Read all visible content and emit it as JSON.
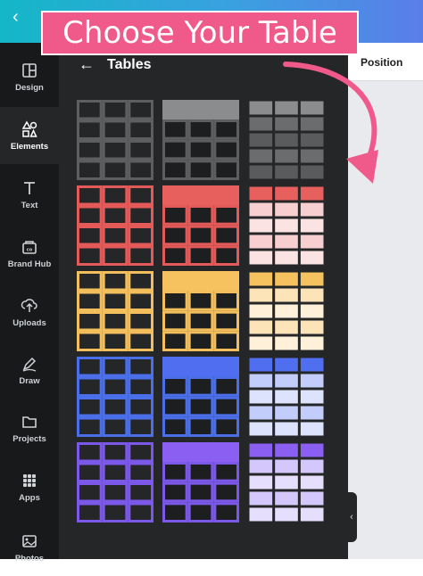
{
  "callout": {
    "text": "Choose Your Table"
  },
  "panel": {
    "title": "Tables"
  },
  "right": {
    "position_label": "Position"
  },
  "rail": {
    "items": [
      {
        "label": "Design",
        "icon": "layout-icon"
      },
      {
        "label": "Elements",
        "icon": "shapes-icon"
      },
      {
        "label": "Text",
        "icon": "text-icon"
      },
      {
        "label": "Brand Hub",
        "icon": "brand-hub-icon"
      },
      {
        "label": "Uploads",
        "icon": "upload-icon"
      },
      {
        "label": "Draw",
        "icon": "pen-icon"
      },
      {
        "label": "Projects",
        "icon": "folder-icon"
      },
      {
        "label": "Apps",
        "icon": "apps-grid-icon"
      },
      {
        "label": "Photos",
        "icon": "photo-icon"
      }
    ],
    "active_index": 1
  },
  "tables": {
    "rows": [
      {
        "name": "gray",
        "dark": "#5d5e60",
        "head": "#8b8c8e",
        "light": "#6b6c6e",
        "cell2": "#5a5b5d"
      },
      {
        "name": "red",
        "dark": "#e35a59",
        "head": "#e8605d",
        "light": "#f8cfd0",
        "cell2": "#fbe3e3"
      },
      {
        "name": "yellow",
        "dark": "#f2bf5c",
        "head": "#f5c25f",
        "light": "#fde3b8",
        "cell2": "#fff0d9"
      },
      {
        "name": "blue",
        "dark": "#4a6fe8",
        "head": "#4f6ff0",
        "light": "#c3cdfb",
        "cell2": "#dde3fd"
      },
      {
        "name": "purple",
        "dark": "#7b58e8",
        "head": "#8a5ff2",
        "light": "#d3c7fb",
        "cell2": "#e6defd"
      }
    ]
  },
  "colors": {
    "accent": "#f05a8a",
    "panel": "#252627",
    "rail": "#18191b"
  }
}
